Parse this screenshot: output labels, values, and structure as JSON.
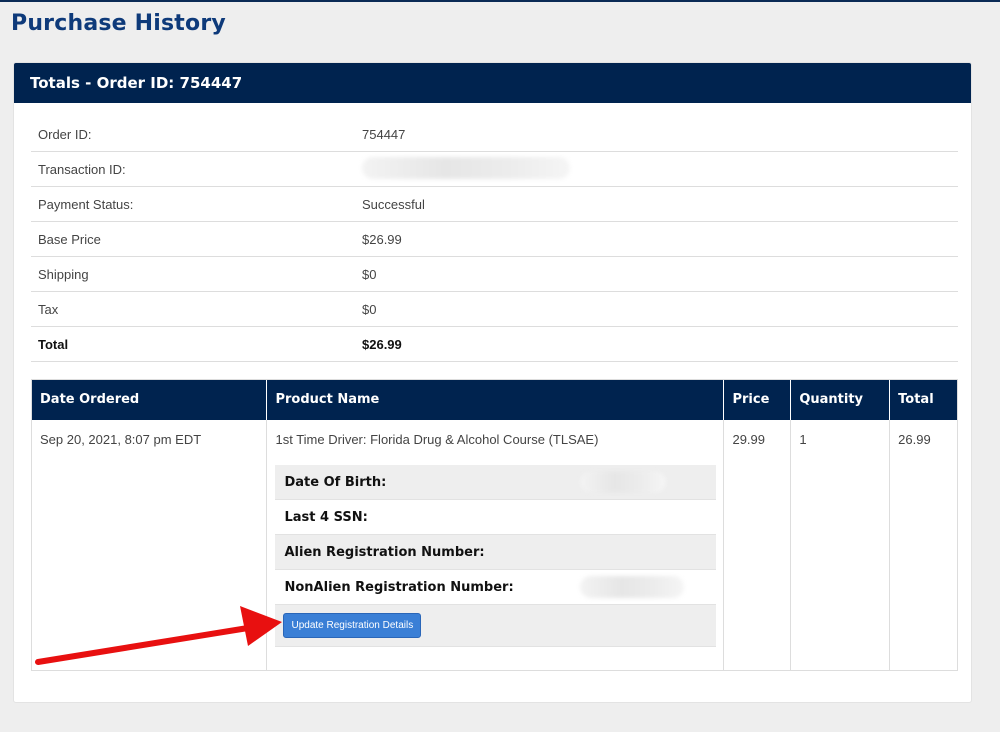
{
  "page": {
    "title": "Purchase History"
  },
  "card": {
    "header": "Totals - Order ID: 754447"
  },
  "summary": [
    {
      "label": "Order ID:",
      "value": "754447"
    },
    {
      "label": "Transaction ID:",
      "value": ""
    },
    {
      "label": "Payment Status:",
      "value": "Successful"
    },
    {
      "label": "Base Price",
      "value": "$26.99"
    },
    {
      "label": "Shipping",
      "value": "$0"
    },
    {
      "label": "Tax",
      "value": "$0"
    },
    {
      "label": "Total",
      "value": "$26.99"
    }
  ],
  "orders": {
    "headers": [
      "Date Ordered",
      "Product Name",
      "Price",
      "Quantity",
      "Total"
    ],
    "row": {
      "date": "Sep 20, 2021, 8:07 pm EDT",
      "product": "1st Time Driver: Florida Drug & Alcohol Course (TLSAE)",
      "price": "29.99",
      "quantity": "1",
      "total": "26.99"
    },
    "registration": {
      "dob_label": "Date Of Birth:",
      "ssn_label": "Last 4 SSN:",
      "alien_label": "Alien Registration Number:",
      "nonalien_label": "NonAlien Registration Number:",
      "update_button": "Update Registration Details"
    }
  },
  "colors": {
    "header_bg": "#00234f",
    "title": "#0e3a7a",
    "button": "#3a7fd6",
    "arrow": "#e81010"
  }
}
